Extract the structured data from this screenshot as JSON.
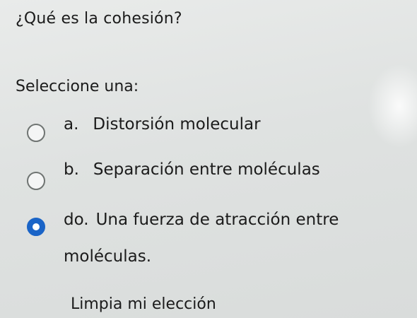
{
  "question": "¿Qué es la cohesión?",
  "prompt": "Seleccione una:",
  "options": [
    {
      "letter": "a.",
      "text": "Distorsión molecular",
      "selected": false
    },
    {
      "letter": "b.",
      "text": "Separación entre moléculas",
      "selected": false
    },
    {
      "letter": "do.",
      "text": "Una fuerza de atracción entre moléculas.",
      "selected": true
    }
  ],
  "clear_choice": "Limpia mi elección",
  "colors": {
    "selected_radio": "#1a64c7",
    "text": "#1b1b1b"
  }
}
